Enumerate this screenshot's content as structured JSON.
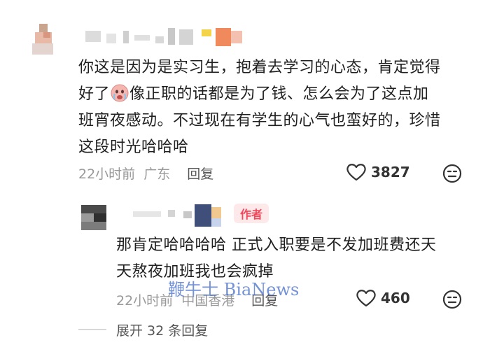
{
  "comment": {
    "lines": [
      "你这是因为是实习生，抱着去学习的心态，肯定觉得",
      "像正职的话都是为了钱、怎么会为了这点加",
      "班宵夜感动。不过现在有学生的心气也蛮好的，珍惜",
      "这段时光哈哈哈"
    ],
    "line2_prefix": "好了",
    "emoji": "crying-face-emoji",
    "time": "22小时前",
    "location": "广东",
    "reply_label": "回复",
    "likes": "3827"
  },
  "reply": {
    "badge": "作者",
    "lines": [
      "那肯定哈哈哈哈 正式入职要是不发加班费还天",
      "天熬夜加班我也会疯掉"
    ],
    "time": "22小时前",
    "location": "中国香港",
    "reply_label": "回复",
    "likes": "460"
  },
  "watermark": "鞭牛士 BiaNews",
  "expand": "展开 32 条回复",
  "colors": {
    "badge_bg": "#fde8ea",
    "badge_text": "#f0485a",
    "meta_gray": "#999999"
  }
}
